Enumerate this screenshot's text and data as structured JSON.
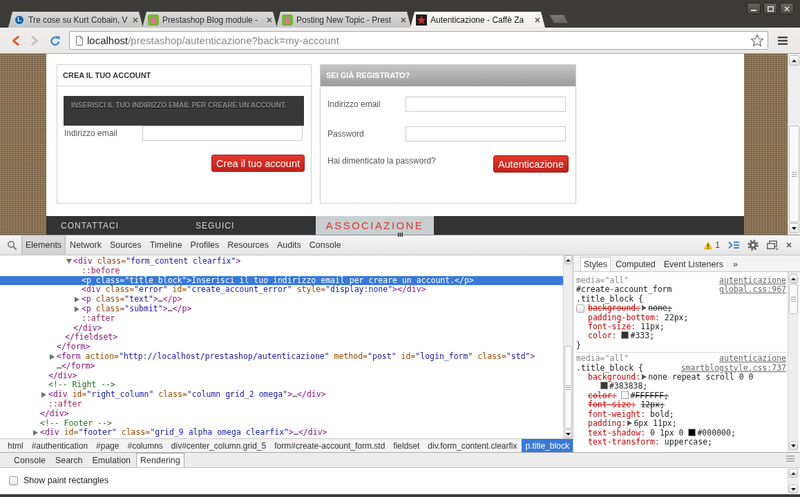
{
  "browser": {
    "tabs": [
      {
        "title": "Tre cose su Kurt Cobain, V",
        "selected": false,
        "kind": "letter",
        "favicon_text": "L"
      },
      {
        "title": "Prestashop Blog module -",
        "selected": false,
        "kind": "tile"
      },
      {
        "title": "Posting New Topic - Prest",
        "selected": false,
        "kind": "tile"
      },
      {
        "title": "Autenticazione - Caffè Za",
        "selected": true,
        "kind": "star"
      }
    ],
    "toolbar": {
      "back": {
        "disabled": false
      },
      "forward": {
        "disabled": true
      },
      "url": {
        "host": "localhost",
        "path": "/prestashop/autenticazione?back=my-account"
      }
    }
  },
  "page": {
    "create_account": {
      "title": "CREA IL TUO ACCOUNT",
      "notice": "INSERISCI IL TUO INDIRIZZO EMAIL PER CREARE UN ACCOUNT.",
      "email_label": "Indirizzo email",
      "button": "Crea il tuo account"
    },
    "login": {
      "title": "SEI GIÀ REGISTRATO?",
      "email_label": "Indirizzo email",
      "password_label": "Password",
      "forgot_link": "Hai dimenticato la password?",
      "button": "Autenticazione"
    },
    "footer": {
      "headings": [
        "CONTATTACI",
        "SEGUICI"
      ],
      "banner": "ASSOCIAZIONE"
    }
  },
  "devtools": {
    "panels": [
      {
        "label": "Elements",
        "selected": true
      },
      {
        "label": "Network",
        "selected": false
      },
      {
        "label": "Sources",
        "selected": false
      },
      {
        "label": "Timeline",
        "selected": false
      },
      {
        "label": "Profiles",
        "selected": false
      },
      {
        "label": "Resources",
        "selected": false
      },
      {
        "label": "Audits",
        "selected": false
      },
      {
        "label": "Console",
        "selected": false
      }
    ],
    "warnings": "1",
    "dom_tree": [
      {
        "close": "</div>",
        "selected": false,
        "kind": "element",
        "children": [
          {
            "close": "</div>",
            "selected": false,
            "kind": "element",
            "children": [
              {
                "close": "</form>",
                "selected": false,
                "kind": "element",
                "children": [
                  {
                    "close": "</fieldset>",
                    "selected": false,
                    "kind": "element",
                    "children": [
                      {
                        "open": "<div class=\"form_content clearfix\">",
                        "close": "</div>",
                        "expanded": true,
                        "selected": false,
                        "kind": "element",
                        "children": [
                          {
                            "open": "::before",
                            "selected": false,
                            "kind": "pseudo"
                          },
                          {
                            "open": "<p class=\"title_block\">Inserisci il tuo indirizzo email per creare un account.</p>",
                            "selected": true,
                            "kind": "element"
                          },
                          {
                            "open": "<div class=\"error\" id=\"create_account_error\" style=\"display:none\"></div>",
                            "selected": false,
                            "kind": "element"
                          },
                          {
                            "open": "<p class=\"text\">…</p>",
                            "expanded": false,
                            "selected": false,
                            "kind": "element"
                          },
                          {
                            "open": "<p class=\"submit\">…</p>",
                            "expanded": false,
                            "selected": false,
                            "kind": "element"
                          },
                          {
                            "open": "::after",
                            "selected": false,
                            "kind": "pseudo"
                          }
                        ]
                      }
                    ]
                  }
                ]
              },
              {
                "open": "<form action=\"http://localhost/prestashop/autenticazione\" method=\"post\" id=\"login_form\" class=\"std\">…</form>",
                "expanded": false,
                "selected": false,
                "kind": "element"
              }
            ]
          },
          {
            "open": "<!-- Right -->",
            "selected": false,
            "kind": "comment"
          },
          {
            "open": "<div id=\"right_column\" class=\"column grid_2 omega\">…</div>",
            "expanded": false,
            "selected": false,
            "kind": "element"
          },
          {
            "open": "::after",
            "selected": false,
            "kind": "pseudo"
          }
        ]
      },
      {
        "open": "<!-- Footer -->",
        "selected": false,
        "kind": "comment"
      },
      {
        "open": "<div id=\"footer\" class=\"grid_9 alpha omega clearfix\">…</div>",
        "expanded": false,
        "selected": false,
        "kind": "element"
      }
    ],
    "breadcrumbs": [
      {
        "label": "html",
        "selected": false
      },
      {
        "label": "#authentication",
        "selected": false
      },
      {
        "label": "#page",
        "selected": false
      },
      {
        "label": "#columns",
        "selected": false
      },
      {
        "label": "div#center_column.grid_5",
        "selected": false
      },
      {
        "label": "form#create-account_form.std",
        "selected": false
      },
      {
        "label": "fieldset",
        "selected": false
      },
      {
        "label": "div.form_content.clearfix",
        "selected": false
      },
      {
        "label": "p.title_block",
        "selected": true
      }
    ],
    "styles_pane": {
      "tabs": [
        {
          "label": "Styles",
          "selected": true
        },
        {
          "label": "Computed",
          "selected": false
        },
        {
          "label": "Event Listeners",
          "selected": false
        }
      ],
      "more": "»",
      "rules": [
        {
          "media": "media=\"all\"",
          "origin": "autenticazione",
          "selector": "#create-account_form .title_block {",
          "source": "global.css:967",
          "properties": [
            {
              "name": "background:",
              "expandable": true,
              "value": "none;",
              "disabled": true,
              "overridden": false
            },
            {
              "name": "padding-bottom:",
              "expandable": false,
              "value": "22px;",
              "disabled": false,
              "overridden": false
            },
            {
              "name": "font-size:",
              "expandable": false,
              "value": "11px;",
              "disabled": false,
              "overridden": false
            },
            {
              "name": "color:",
              "expandable": false,
              "color": "#333333",
              "color_value": "#333;",
              "disabled": false,
              "overridden": false
            }
          ],
          "close": "}"
        },
        {
          "media": "media=\"all\"",
          "origin": "autenticazione",
          "selector": ".title_block {",
          "source": "smartblogstyle.css:737",
          "properties": [
            {
              "name": "background:",
              "expandable": true,
              "value": "none repeat scroll 0 0",
              "color": "#383838",
              "color_value": "#383838;",
              "disabled": false,
              "overridden": false
            },
            {
              "name": "color:",
              "expandable": false,
              "color": "#ffffff",
              "color_value": "#FFFFFF;",
              "disabled": false,
              "overridden": true
            },
            {
              "name": "font-size:",
              "expandable": false,
              "value": "12px;",
              "disabled": false,
              "overridden": true
            },
            {
              "name": "font-weight:",
              "expandable": false,
              "value": "bold;",
              "disabled": false,
              "overridden": false
            },
            {
              "name": "padding:",
              "expandable": true,
              "value": "6px 11px;",
              "disabled": false,
              "overridden": false
            },
            {
              "name": "text-shadow:",
              "expandable": false,
              "value": "0 1px 0",
              "color": "#000000",
              "color_value": "#000000;",
              "disabled": false,
              "overridden": false
            },
            {
              "name": "text-transform:",
              "expandable": false,
              "value": "uppercase;",
              "disabled": false,
              "overridden": false
            }
          ]
        }
      ]
    },
    "drawer_tabs": [
      {
        "label": "Console",
        "selected": false
      },
      {
        "label": "Search",
        "selected": false
      },
      {
        "label": "Emulation",
        "selected": false
      },
      {
        "label": "Rendering",
        "selected": true
      }
    ],
    "rendering_options": [
      {
        "label": "Show paint rectangles",
        "checked": false
      }
    ]
  }
}
